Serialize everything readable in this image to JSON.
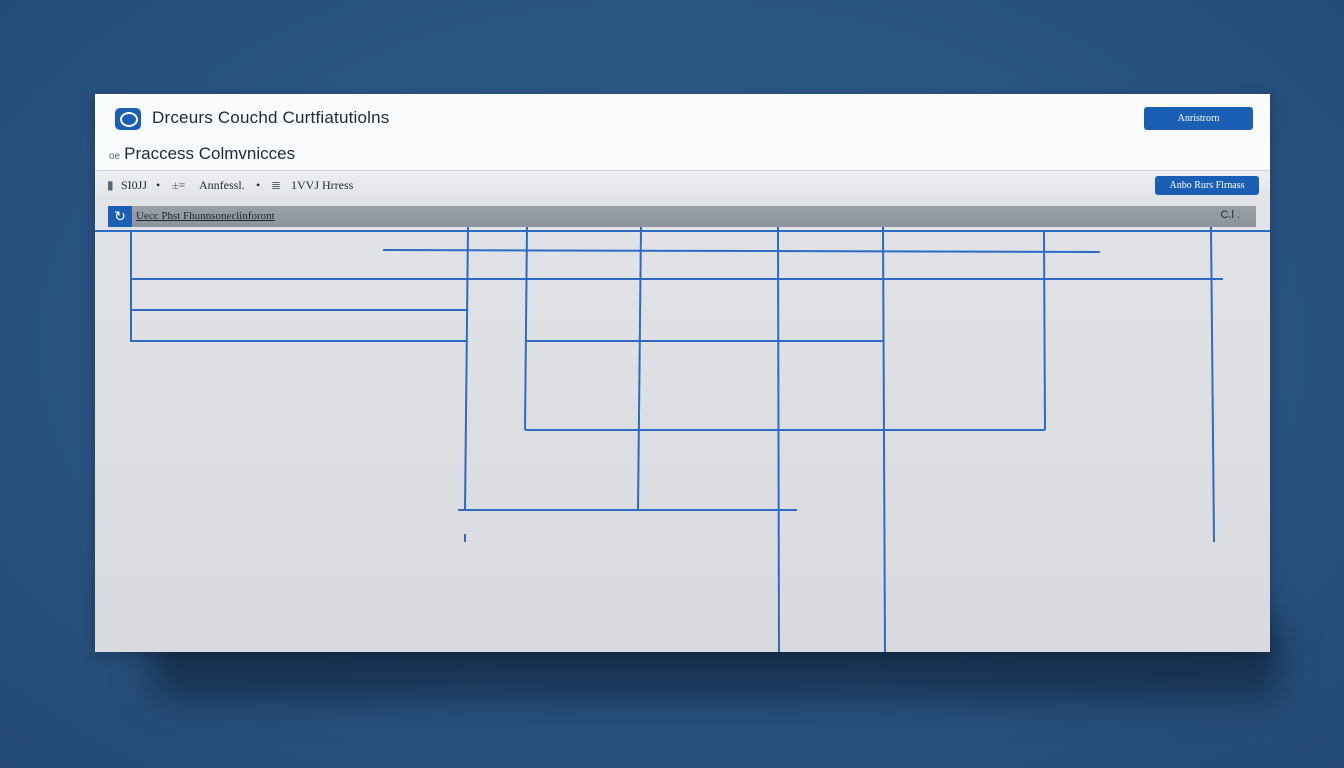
{
  "window": {
    "title": "Drceurs Couchd Curtfiatutiolns",
    "primary_button": "Anristrorn",
    "subtitle": "Praccess Colmvnicces",
    "subtitle_icon": "oe"
  },
  "toolbar": {
    "items": [
      {
        "icon": "▮",
        "label": "SI0JJ"
      },
      {
        "icon": "•",
        "label": ""
      },
      {
        "icon": "±≡",
        "label": "Annfessl."
      },
      {
        "icon": "•",
        "label": ""
      },
      {
        "icon": "≣",
        "label": "1VVJ Hrress"
      }
    ],
    "right_button": "Anbo Rurs Flrnass"
  },
  "pathbar": {
    "text": "Uecc Phst Fhunnsoneclinforont",
    "right_text": "C.l ."
  },
  "colors": {
    "accent": "#1b5fb4",
    "grid_line": "#2e6bc1",
    "background": "#2a5482"
  }
}
